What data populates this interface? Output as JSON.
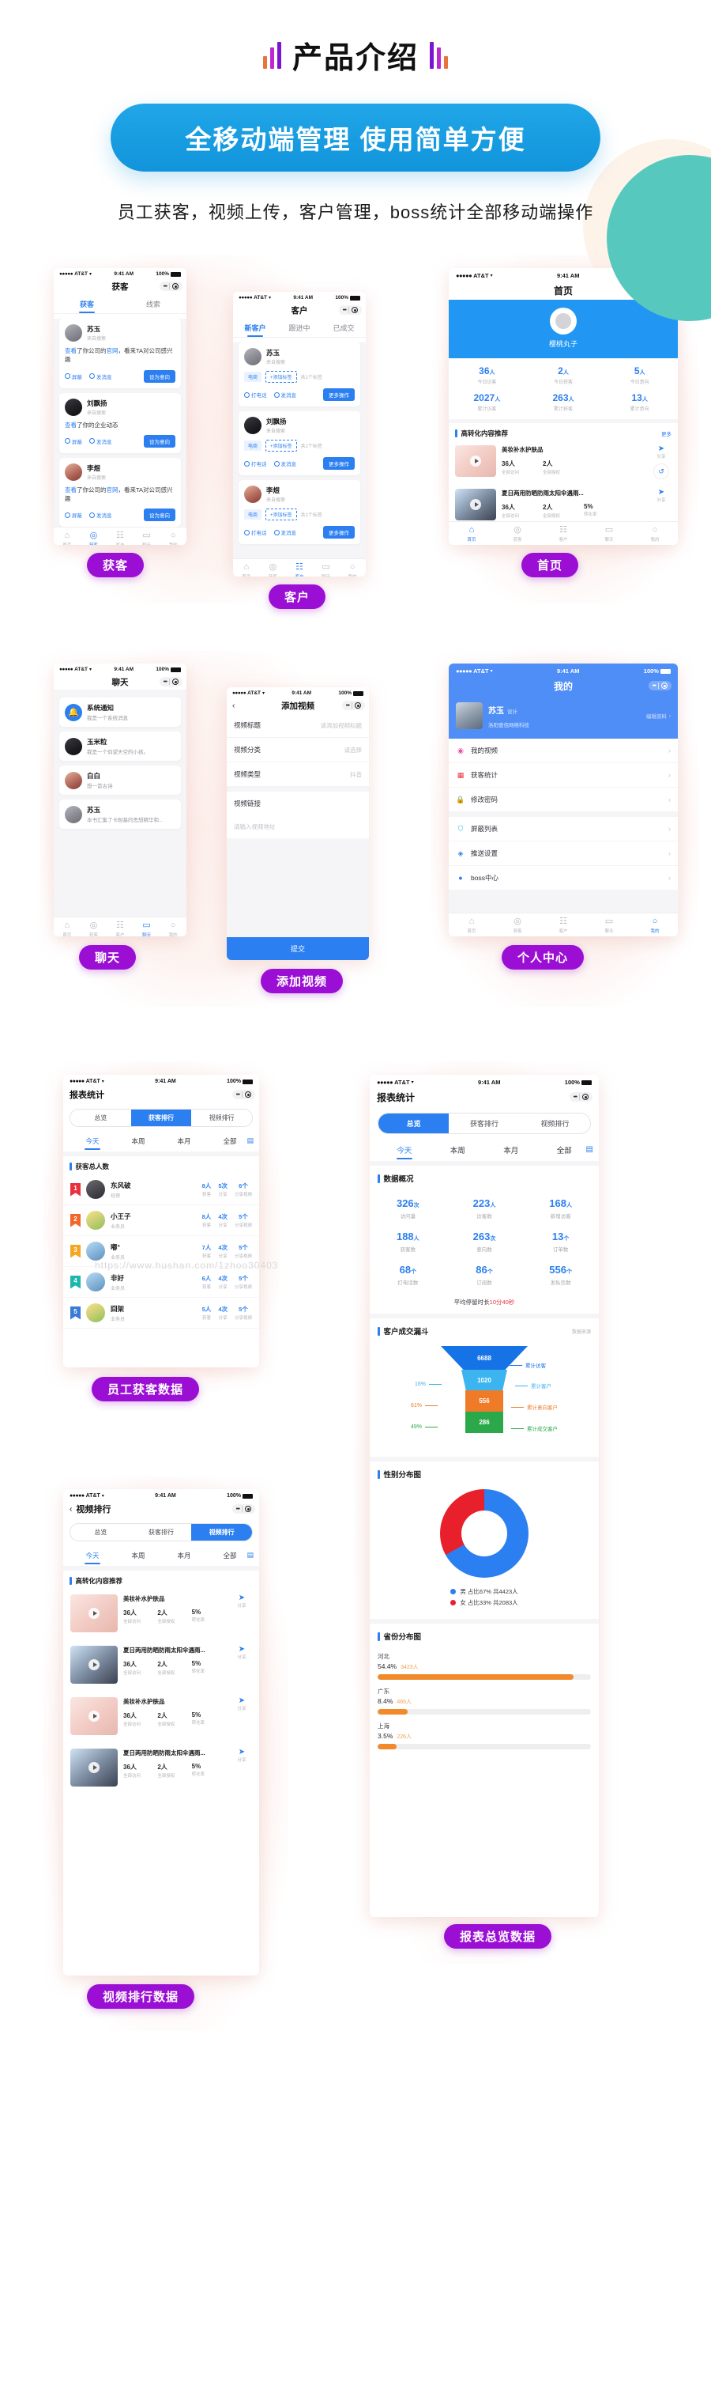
{
  "header": {
    "title": "产品介绍",
    "pill": "全移动端管理 使用简单方便",
    "subtitle": "员工获客，视频上传，客户管理，boss统计全部移动端操作"
  },
  "status_bar": {
    "carrier": "AT&T",
    "time": "9:41 AM",
    "battery": "100%"
  },
  "labels": {
    "huoke": "获客",
    "kehu": "客户",
    "shouye": "首页",
    "liaotian": "聊天",
    "tianjiashipin": "添加视频",
    "gerenzhongxin": "个人中心",
    "yuangonghuoke": "员工获客数据",
    "shipinpaihang": "视频排行数据",
    "baobiaozonglan": "报表总览数据"
  },
  "tabbar": {
    "items": [
      {
        "icon": "home-icon",
        "label": "首页"
      },
      {
        "icon": "target-icon",
        "label": "获客"
      },
      {
        "icon": "customer-icon",
        "label": "客户"
      },
      {
        "icon": "chat-icon",
        "label": "聊天"
      },
      {
        "icon": "person-icon",
        "label": "我的"
      }
    ]
  },
  "screen_huoke": {
    "title": "获客",
    "tabs": [
      "获客",
      "线索"
    ],
    "active_tab": "获客",
    "items": [
      {
        "name": "苏玉",
        "from": "来自搜索",
        "desc_pre": "查看",
        "desc_mid": "了你公司的",
        "desc_link": "官网",
        "desc_post": "，看来TA对公司感兴趣",
        "a1": "屏蔽",
        "a2": "发消息",
        "btn": "设为意向"
      },
      {
        "name": "刘飘扬",
        "from": "来自搜索",
        "desc_pre": "查看",
        "desc_mid": "了你的企业动态",
        "desc_link": "",
        "desc_post": "",
        "a1": "屏蔽",
        "a2": "发消息",
        "btn": "设为意向"
      },
      {
        "name": "李煜",
        "from": "来自搜索",
        "desc_pre": "查看",
        "desc_mid": "了你公司的",
        "desc_link": "官网",
        "desc_post": "，看来TA对公司感兴趣",
        "a1": "屏蔽",
        "a2": "发消息",
        "btn": "设为意向"
      }
    ]
  },
  "screen_kehu": {
    "title": "客户",
    "tabs": [
      "新客户",
      "跟进中",
      "已成交"
    ],
    "active_tab": "新客户",
    "items": [
      {
        "name": "苏玉",
        "from": "来自搜索",
        "tag": "电商",
        "addtag": "+添加标签",
        "note": "共1个标签",
        "a1": "打电话",
        "a2": "发消息",
        "btn": "更多操作"
      },
      {
        "name": "刘飘扬",
        "from": "来自搜索",
        "tag": "电商",
        "addtag": "+添加标签",
        "note": "共1个标签",
        "a1": "打电话",
        "a2": "发消息",
        "btn": "更多操作"
      },
      {
        "name": "李煜",
        "from": "来自搜索",
        "tag": "电商",
        "addtag": "+添加标签",
        "note": "共1个标签",
        "a1": "打电话",
        "a2": "发消息",
        "btn": "更多操作"
      }
    ]
  },
  "screen_home": {
    "title": "首页",
    "user": "樱桃丸子",
    "stats": [
      {
        "value": "36",
        "unit": "人",
        "label": "今日访客"
      },
      {
        "value": "2",
        "unit": "人",
        "label": "今日获客"
      },
      {
        "value": "5",
        "unit": "人",
        "label": "今日意向"
      },
      {
        "value": "2027",
        "unit": "人",
        "label": "累计访客"
      },
      {
        "value": "263",
        "unit": "人",
        "label": "累计获客"
      },
      {
        "value": "13",
        "unit": "人",
        "label": "累计意向"
      }
    ],
    "section_title": "高转化内容推荐",
    "more": "更多",
    "videos": [
      {
        "title": "美妆补水护肤品",
        "n1": "36人",
        "l1": "全部访问",
        "n2": "2人",
        "l2": "全部授权",
        "n3": "",
        "l3": "",
        "share": "分享",
        "back": "返回"
      },
      {
        "title": "夏日两用防晒防雨太阳伞遇雨...",
        "n1": "36人",
        "l1": "全部访问",
        "n2": "2人",
        "l2": "全部授权",
        "n3": "5%",
        "l3": "转化率",
        "share": "分享",
        "back": "返回"
      }
    ]
  },
  "screen_chat": {
    "title": "聊天",
    "items": [
      {
        "name": "系统通知",
        "msg": "我是一个系统消息"
      },
      {
        "name": "玉米粒",
        "msg": "我是一个仰望天空的小孩。"
      },
      {
        "name": "白白",
        "msg": "想一首古诗"
      },
      {
        "name": "苏玉",
        "msg": "本书汇集了卡耐基的思想精华和..."
      }
    ]
  },
  "screen_addvideo": {
    "title": "添加视频",
    "fields": [
      {
        "label": "视频标题",
        "value": "请添加视频标题"
      },
      {
        "label": "视频分类",
        "value": "请选择"
      },
      {
        "label": "视频类型",
        "value": "抖音"
      }
    ],
    "link_label": "视频链接",
    "link_placeholder": "请输入视频地址",
    "submit": "提交"
  },
  "screen_mine": {
    "title": "我的",
    "name": "苏玉",
    "role": "设计",
    "company": "洛阳壹佰网络科技",
    "edit": "编辑资料",
    "menu": [
      {
        "icon": "video-icon",
        "label": "我的视频"
      },
      {
        "icon": "stats-icon",
        "label": "获客统计"
      },
      {
        "icon": "lock-icon",
        "label": "修改密码"
      },
      {
        "icon": "shield-icon",
        "label": "屏蔽列表"
      },
      {
        "icon": "push-icon",
        "label": "推送设置"
      },
      {
        "icon": "boss-icon",
        "label": "boss中心"
      }
    ]
  },
  "screen_rank": {
    "title": "报表统计",
    "segments": [
      "总览",
      "获客排行",
      "视频排行"
    ],
    "active_segment": "获客排行",
    "date_tabs": [
      "今天",
      "本周",
      "本月",
      "全部"
    ],
    "active_date": "今天",
    "section_title": "获客总人数",
    "rows": [
      {
        "rank": "1",
        "name": "东风破",
        "position": "经理",
        "n1": "8人",
        "l1": "获客",
        "n2": "5次",
        "l2": "分享",
        "n3": "6个",
        "l3": "分享视频"
      },
      {
        "rank": "2",
        "name": "小王子",
        "position": "业务员",
        "n1": "8人",
        "l1": "获客",
        "n2": "4次",
        "l2": "分享",
        "n3": "5个",
        "l3": "分享视频"
      },
      {
        "rank": "3",
        "name": "嘟°",
        "position": "业务员",
        "n1": "7人",
        "l1": "获客",
        "n2": "4次",
        "l2": "分享",
        "n3": "5个",
        "l3": "分享视频"
      },
      {
        "rank": "4",
        "name": "非好",
        "position": "业务员",
        "n1": "6人",
        "l1": "获客",
        "n2": "4次",
        "l2": "分享",
        "n3": "5个",
        "l3": "分享视频"
      },
      {
        "rank": "5",
        "name": "囧架",
        "position": "业务员",
        "n1": "5人",
        "l1": "获客",
        "n2": "4次",
        "l2": "分享",
        "n3": "5个",
        "l3": "分享视频"
      }
    ]
  },
  "screen_videorank": {
    "title": "视频排行",
    "segments": [
      "总览",
      "获客排行",
      "视频排行"
    ],
    "active_segment": "视频排行",
    "date_tabs": [
      "今天",
      "本周",
      "本月",
      "全部"
    ],
    "active_date": "今天",
    "section_title": "高转化内容推荐",
    "videos": [
      {
        "title": "美妆补水护肤品",
        "n1": "36人",
        "l1": "全部访问",
        "n2": "2人",
        "l2": "全部授权",
        "n3": "5%",
        "l3": "转化率",
        "share": "分享"
      },
      {
        "title": "夏日两用防晒防雨太阳伞遇雨...",
        "n1": "36人",
        "l1": "全部访问",
        "n2": "2人",
        "l2": "全部授权",
        "n3": "5%",
        "l3": "转化率",
        "share": "分享"
      },
      {
        "title": "美妆补水护肤品",
        "n1": "36人",
        "l1": "全部访问",
        "n2": "2人",
        "l2": "全部授权",
        "n3": "5%",
        "l3": "转化率",
        "share": "分享"
      },
      {
        "title": "夏日两用防晒防雨太阳伞遇雨...",
        "n1": "36人",
        "l1": "全部访问",
        "n2": "2人",
        "l2": "全部授权",
        "n3": "5%",
        "l3": "转化率",
        "share": "分享"
      }
    ]
  },
  "screen_overview": {
    "title": "报表统计",
    "segments": [
      "总览",
      "获客排行",
      "视频排行"
    ],
    "active_segment": "总览",
    "date_tabs": [
      "今天",
      "本周",
      "本月",
      "全部"
    ],
    "active_date": "今天",
    "data_title": "数据概况",
    "cells": [
      {
        "value": "326",
        "unit": "次",
        "label": "访问量"
      },
      {
        "value": "223",
        "unit": "人",
        "label": "访客数"
      },
      {
        "value": "168",
        "unit": "人",
        "label": "新增访客"
      },
      {
        "value": "188",
        "unit": "人",
        "label": "获客数"
      },
      {
        "value": "263",
        "unit": "次",
        "label": "意向数"
      },
      {
        "value": "13",
        "unit": "个",
        "label": "订单数"
      },
      {
        "value": "68",
        "unit": "个",
        "label": "打电话数"
      },
      {
        "value": "86",
        "unit": "个",
        "label": "订阅数"
      },
      {
        "value": "556",
        "unit": "个",
        "label": "发私信数"
      }
    ],
    "avg_pre": "平均停留时长",
    "avg_val": "10分40秒",
    "funnel_title": "客户成交漏斗",
    "data_source": "数据来源",
    "gender_title": "性别分布图",
    "province_title": "省份分布图"
  },
  "chart_data": [
    {
      "type": "funnel",
      "title": "客户成交漏斗",
      "stages": [
        {
          "label": "累计访客",
          "value": 6688,
          "rate": "",
          "color": "#1673e6"
        },
        {
          "label": "累计客户",
          "value": 1020,
          "rate": "16%",
          "color": "#3bb4f0"
        },
        {
          "label": "累计意向客户",
          "value": 556,
          "rate": "61%",
          "color": "#ef7b28"
        },
        {
          "label": "累计成交客户",
          "value": 286,
          "rate": "49%",
          "color": "#2aa84a"
        }
      ]
    },
    {
      "type": "pie",
      "title": "性别分布图",
      "legend_position": "bottom",
      "categories": [
        "男",
        "女"
      ],
      "values": [
        4423,
        2083
      ],
      "percents": [
        67,
        33
      ],
      "colors": [
        "#2b7ff0",
        "#e8202c"
      ],
      "legend": [
        "男 占比67% 共4423人",
        "女 占比33% 共2083人"
      ]
    },
    {
      "type": "bar",
      "title": "省份分布图",
      "categories": [
        "河北",
        "广东",
        "上海"
      ],
      "values": [
        54.4,
        8.4,
        3.5
      ],
      "counts": [
        "3423人",
        "465人",
        "226人"
      ],
      "percent_labels": [
        "54.4%",
        "8.4%",
        "3.5%"
      ],
      "ylabel": "",
      "xlabel": "",
      "ylim": [
        0,
        60
      ],
      "color": "#f08a2a",
      "grid": false
    }
  ]
}
